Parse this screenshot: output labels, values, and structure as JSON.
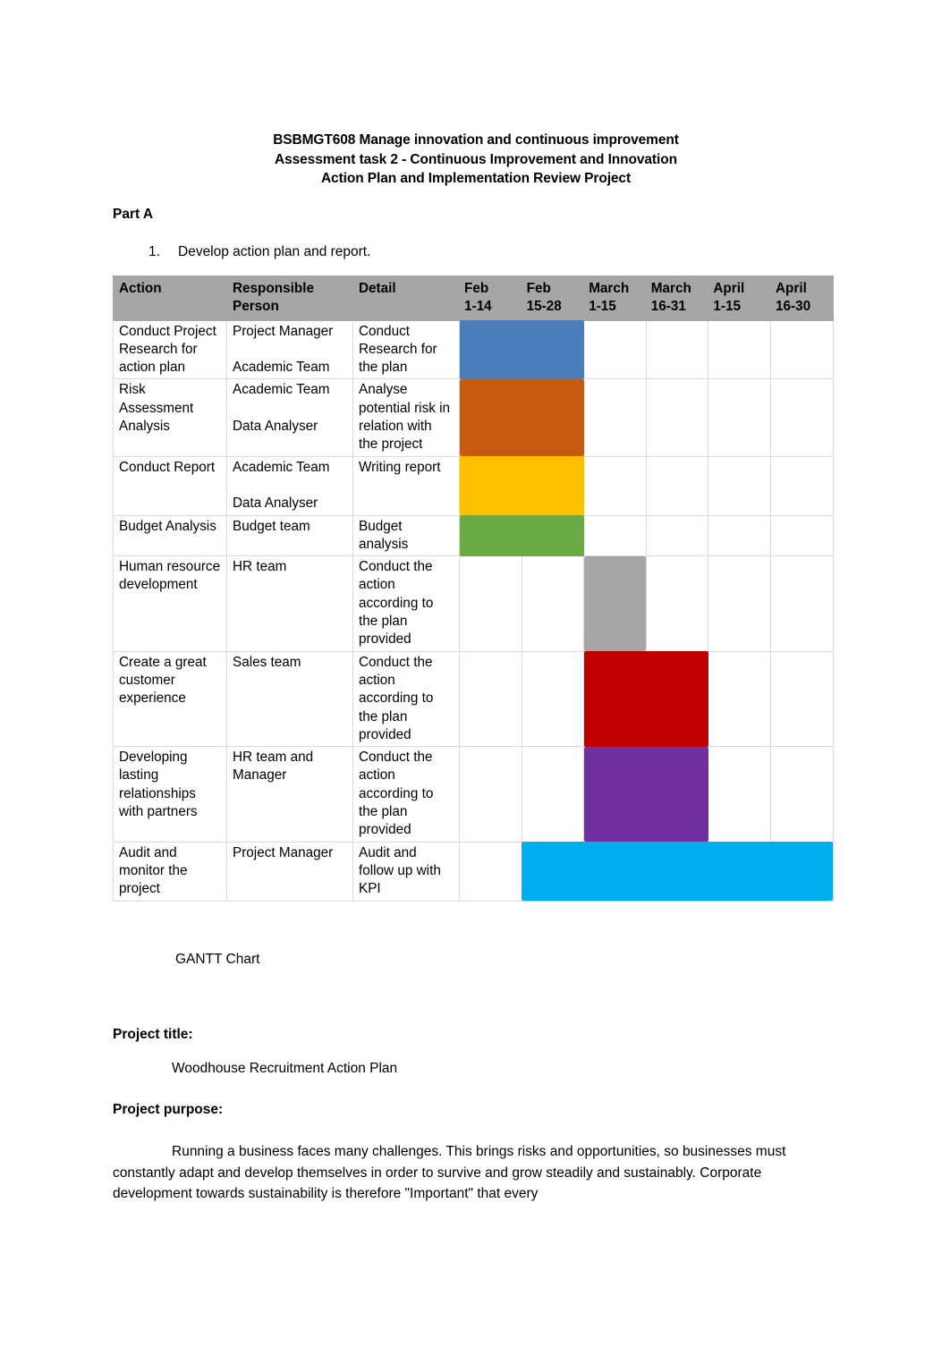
{
  "document": {
    "heading_lines": [
      "BSBMGT608 Manage innovation and continuous improvement",
      "Assessment task 2 - Continuous Improvement and Innovation",
      "Action Plan and Implementation Review Project"
    ],
    "part_label": "Part A",
    "list_number": "1.",
    "list_text": "Develop action plan and report.",
    "gantt_caption": "GANTT Chart",
    "project_title_label": "Project title:",
    "project_title_value": "Woodhouse Recruitment Action Plan",
    "project_purpose_label": "Project purpose:",
    "project_purpose_text": "Running a business faces many challenges. This brings risks and opportunities, so businesses must constantly adapt and develop themselves in order to survive and grow steadily and sustainably. Corporate development towards sustainability is therefore \"Important\" that every"
  },
  "chart_data": {
    "type": "table",
    "title": "GANTT Chart",
    "header_background": "#a6a6a6",
    "grid_color": "#d9d9d9",
    "columns": [
      "Action",
      "Responsible Person",
      "Detail",
      "Feb 1-14",
      "Feb 15-28",
      "March 1-15",
      "March 16-31",
      "April 1-15",
      "April 16-30"
    ],
    "period_columns": [
      {
        "month": "Feb",
        "range": "1-14"
      },
      {
        "month": "Feb",
        "range": "15-28"
      },
      {
        "month": "March",
        "range": "1-15"
      },
      {
        "month": "March",
        "range": "16-31"
      },
      {
        "month": "April",
        "range": "1-15"
      },
      {
        "month": "April",
        "range": "16-30"
      }
    ],
    "rows": [
      {
        "action": "Conduct Project Research for action plan",
        "responsible_1": "Project Manager",
        "responsible_2": "Academic Team",
        "detail": "Conduct Research for the plan",
        "bar_color": "#4A7EBB",
        "bar_start": 0,
        "bar_span": 2
      },
      {
        "action": "Risk Assessment Analysis",
        "responsible_1": "Academic Team",
        "responsible_2": "Data Analyser",
        "detail": "Analyse potential risk in relation with the project",
        "bar_color": "#C55A11",
        "bar_start": 0,
        "bar_span": 2
      },
      {
        "action": "Conduct Report",
        "responsible_1": "Academic Team",
        "responsible_2": "Data Analyser",
        "detail": "Writing report",
        "bar_color": "#FFC000",
        "bar_start": 0,
        "bar_span": 2
      },
      {
        "action": "Budget Analysis",
        "responsible_1": "Budget team",
        "responsible_2": "",
        "detail": "Budget analysis",
        "bar_color": "#6AAB45",
        "bar_start": 0,
        "bar_span": 2
      },
      {
        "action": "Human resource development",
        "responsible_1": "HR team",
        "responsible_2": "",
        "detail": "Conduct the action according to the plan provided",
        "bar_color": "#A6A6A6",
        "bar_start": 2,
        "bar_span": 1
      },
      {
        "action": "Create a great customer experience",
        "responsible_1": "Sales team",
        "responsible_2": "",
        "detail": "Conduct the action according to the plan provided",
        "bar_color": "#C00000",
        "bar_start": 2,
        "bar_span": 2
      },
      {
        "action": "Developing lasting relationships with partners",
        "responsible_1": "HR team and Manager",
        "responsible_2": "",
        "detail": "Conduct the action according to the plan provided",
        "bar_color": "#7030A0",
        "bar_start": 2,
        "bar_span": 2
      },
      {
        "action": "Audit and monitor the project",
        "responsible_1": "Project Manager",
        "responsible_2": "",
        "detail": "Audit and follow up with KPI",
        "bar_color": "#00AEEF",
        "bar_start": 1,
        "bar_span": 5
      }
    ]
  }
}
